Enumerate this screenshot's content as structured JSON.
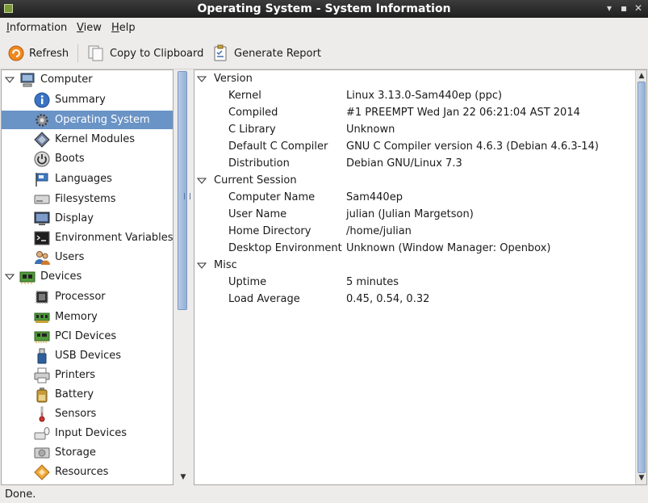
{
  "window": {
    "title": "Operating System - System Information"
  },
  "menu": [
    {
      "label": "Information",
      "underline": "I"
    },
    {
      "label": "View",
      "underline": "V"
    },
    {
      "label": "Help",
      "underline": "H"
    }
  ],
  "toolbar": {
    "refresh": "Refresh",
    "copy": "Copy to Clipboard",
    "report": "Generate Report"
  },
  "tree": {
    "computer": "Computer",
    "computer_items": [
      "Summary",
      "Operating System",
      "Kernel Modules",
      "Boots",
      "Languages",
      "Filesystems",
      "Display",
      "Environment Variables",
      "Users"
    ],
    "devices": "Devices",
    "device_items": [
      "Processor",
      "Memory",
      "PCI Devices",
      "USB Devices",
      "Printers",
      "Battery",
      "Sensors",
      "Input Devices",
      "Storage",
      "Resources"
    ],
    "selected": "Operating System"
  },
  "details": {
    "version": {
      "title": "Version",
      "rows": [
        {
          "key": "Kernel",
          "value": "Linux 3.13.0-Sam440ep (ppc)"
        },
        {
          "key": "Compiled",
          "value": "#1 PREEMPT Wed Jan 22 06:21:04 AST 2014"
        },
        {
          "key": "C Library",
          "value": "Unknown"
        },
        {
          "key": "Default C Compiler",
          "value": "GNU C Compiler version 4.6.3 (Debian 4.6.3-14)"
        },
        {
          "key": "Distribution",
          "value": "Debian GNU/Linux 7.3"
        }
      ]
    },
    "session": {
      "title": "Current Session",
      "rows": [
        {
          "key": "Computer Name",
          "value": "Sam440ep"
        },
        {
          "key": "User Name",
          "value": "julian (Julian Margetson)"
        },
        {
          "key": "Home Directory",
          "value": "/home/julian"
        },
        {
          "key": "Desktop Environment",
          "value": "Unknown (Window Manager: Openbox)"
        }
      ]
    },
    "misc": {
      "title": "Misc",
      "rows": [
        {
          "key": "Uptime",
          "value": "5 minutes"
        },
        {
          "key": "Load Average",
          "value": "0.45, 0.54, 0.32"
        }
      ]
    }
  },
  "status": {
    "text": "Done."
  },
  "colors": {
    "selection": "#6a93c6",
    "titlebar": "#2a2a2a"
  }
}
